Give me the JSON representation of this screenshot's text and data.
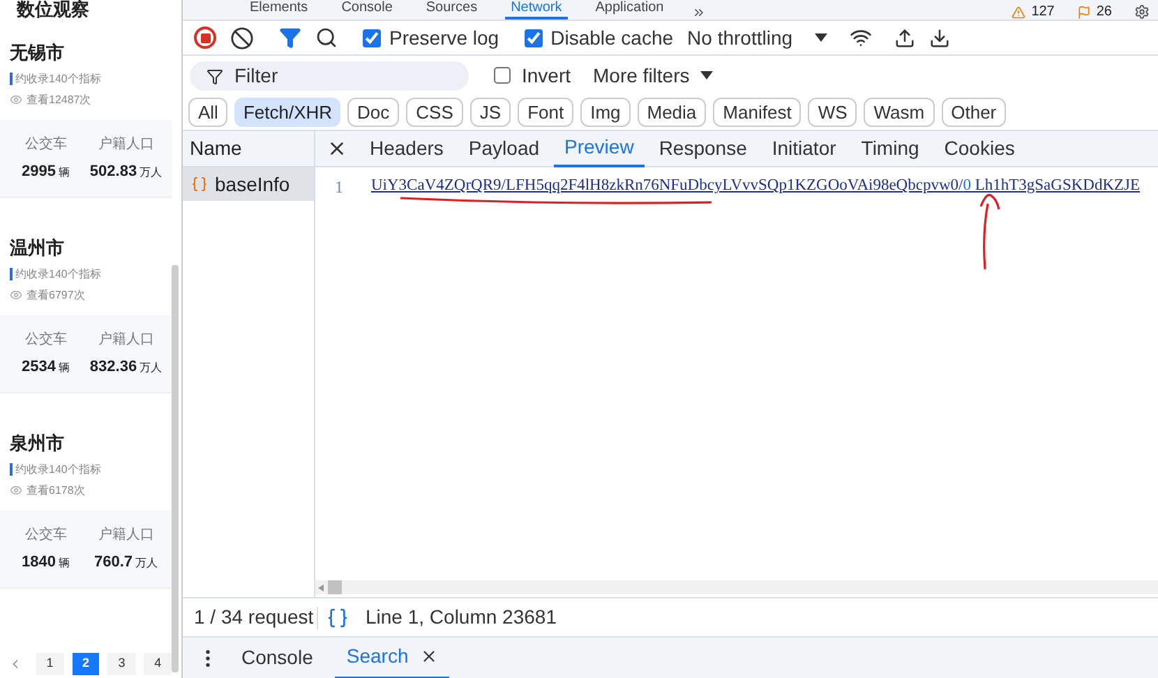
{
  "side_panel": {
    "title": "数位观察",
    "cards": [
      {
        "city": "无锡市",
        "indicators": "约收录140个指标",
        "views": "查看12487次",
        "stats": [
          {
            "label": "公交车",
            "value": "2995",
            "unit": "辆"
          },
          {
            "label": "户籍人口",
            "value": "502.83",
            "unit": "万人"
          }
        ]
      },
      {
        "city": "温州市",
        "indicators": "约收录140个指标",
        "views": "查看6797次",
        "stats": [
          {
            "label": "公交车",
            "value": "2534",
            "unit": "辆"
          },
          {
            "label": "户籍人口",
            "value": "832.36",
            "unit": "万人"
          }
        ]
      },
      {
        "city": "泉州市",
        "indicators": "约收录140个指标",
        "views": "查看6178次",
        "stats": [
          {
            "label": "公交车",
            "value": "1840",
            "unit": "辆"
          },
          {
            "label": "户籍人口",
            "value": "760.7",
            "unit": "万人"
          }
        ]
      }
    ],
    "pages": [
      {
        "label": "1",
        "selected": false
      },
      {
        "label": "2",
        "selected": true
      },
      {
        "label": "3",
        "selected": false
      },
      {
        "label": "4",
        "selected": false
      }
    ]
  },
  "devtools": {
    "panel_tabs": [
      {
        "label": "Elements",
        "selected": false
      },
      {
        "label": "Console",
        "selected": false
      },
      {
        "label": "Sources",
        "selected": false
      },
      {
        "label": "Network",
        "selected": true
      },
      {
        "label": "Application",
        "selected": false
      }
    ],
    "warnings": "127",
    "issues": "26",
    "toolbar": {
      "preserve_log": {
        "label": "Preserve log",
        "checked": true
      },
      "disable_cache": {
        "label": "Disable cache",
        "checked": true
      },
      "throttling": "No throttling"
    },
    "filter": {
      "placeholder": "Filter",
      "invert": {
        "label": "Invert",
        "checked": false
      },
      "more_filters": "More filters"
    },
    "type_filters": [
      {
        "label": "All",
        "selected": false
      },
      {
        "label": "Fetch/XHR",
        "selected": true
      },
      {
        "label": "Doc",
        "selected": false
      },
      {
        "label": "CSS",
        "selected": false
      },
      {
        "label": "JS",
        "selected": false
      },
      {
        "label": "Font",
        "selected": false
      },
      {
        "label": "Img",
        "selected": false
      },
      {
        "label": "Media",
        "selected": false
      },
      {
        "label": "Manifest",
        "selected": false
      },
      {
        "label": "WS",
        "selected": false
      },
      {
        "label": "Wasm",
        "selected": false
      },
      {
        "label": "Other",
        "selected": false
      }
    ],
    "name_header": "Name",
    "requests": [
      {
        "name": "baseInfo",
        "selected": true
      }
    ],
    "detail_tabs": [
      {
        "label": "Headers",
        "selected": false
      },
      {
        "label": "Payload",
        "selected": false
      },
      {
        "label": "Preview",
        "selected": true
      },
      {
        "label": "Response",
        "selected": false
      },
      {
        "label": "Initiator",
        "selected": false
      },
      {
        "label": "Timing",
        "selected": false
      },
      {
        "label": "Cookies",
        "selected": false
      }
    ],
    "preview": {
      "line_number": "1",
      "text_underlined": "UiY3CaV4ZQrQR9/LFH5qq2F4lH8zkRn76NFuDbcyLVvvSQp1KZGOoVAi98eQbcpvw0/",
      "text_marked": "0",
      "text_rest": " Lh1hT3gSaGSKDdKZJE"
    },
    "status": {
      "requests": "1 / 34 request",
      "position": "Line 1, Column 23681"
    },
    "drawer_tabs": [
      {
        "label": "Console",
        "selected": false
      },
      {
        "label": "Search",
        "selected": true
      }
    ]
  }
}
